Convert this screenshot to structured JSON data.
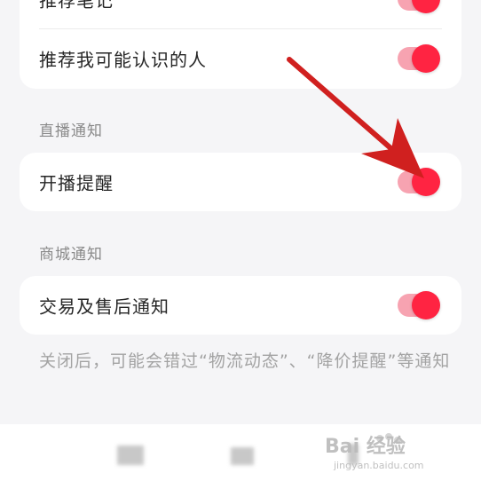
{
  "section1": {
    "items": [
      {
        "label": "推荐笔记",
        "enabled": true
      },
      {
        "label": "推荐我可能认识的人",
        "enabled": true
      }
    ]
  },
  "section2": {
    "header": "直播通知",
    "items": [
      {
        "label": "开播提醒",
        "enabled": true
      }
    ]
  },
  "section3": {
    "header": "商城通知",
    "items": [
      {
        "label": "交易及售后通知",
        "enabled": true
      }
    ],
    "note": "关闭后，可能会错过“物流动态”、“降价提醒”等通知"
  },
  "colors": {
    "accent": "#ff2442",
    "track": "#f7a3b1",
    "arrow": "#d0201f",
    "background": "#f5f5f7"
  },
  "overlay": {
    "annotation": "red-arrow-pointing-to-toggle",
    "watermark_text": "Bai 经验",
    "watermark_sub": "jingyan.baidu.com"
  }
}
